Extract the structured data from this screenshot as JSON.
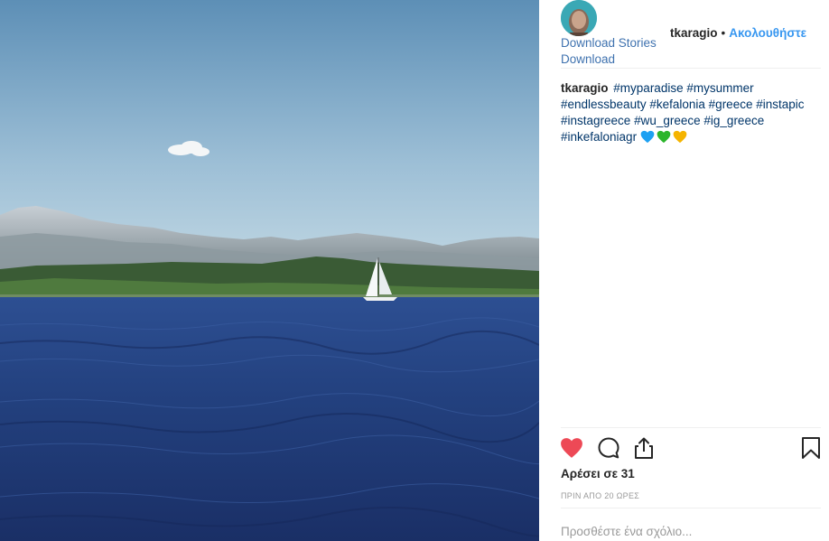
{
  "post": {
    "username": "tkaragio",
    "separator": "•",
    "follow_label": "Ακολουθήστε",
    "download_stories_label": "Download Stories",
    "download_label": "Download",
    "caption": {
      "username": "tkaragio",
      "hashtags": [
        "#myparadise",
        "#mysummer",
        "#endlessbeauty",
        "#kefalonia",
        "#greece",
        "#instapic",
        "#instagreece",
        "#wu_greece",
        "#ig_greece",
        "#inkefaloniagr"
      ],
      "emoji_hearts": [
        {
          "name": "blue-heart-emoji",
          "color": "#1da1f2"
        },
        {
          "name": "green-heart-emoji",
          "color": "#2bb52b"
        },
        {
          "name": "yellow-heart-emoji",
          "color": "#f5b400"
        }
      ]
    },
    "likes_text": "Αρέσει σε 31",
    "timestamp": "ΠΡΙΝ ΑΠΟ 20 ΩΡΕΣ",
    "comment_placeholder": "Προσθέστε ένα σχόλιο...",
    "icons": {
      "like": "heart-icon",
      "comment": "comment-icon",
      "share": "share-icon",
      "save": "bookmark-icon"
    },
    "like_active": true
  },
  "colors": {
    "link_blue": "#3897f0",
    "hashtag": "#003569",
    "like_red": "#ed4956",
    "muted": "#999999"
  }
}
